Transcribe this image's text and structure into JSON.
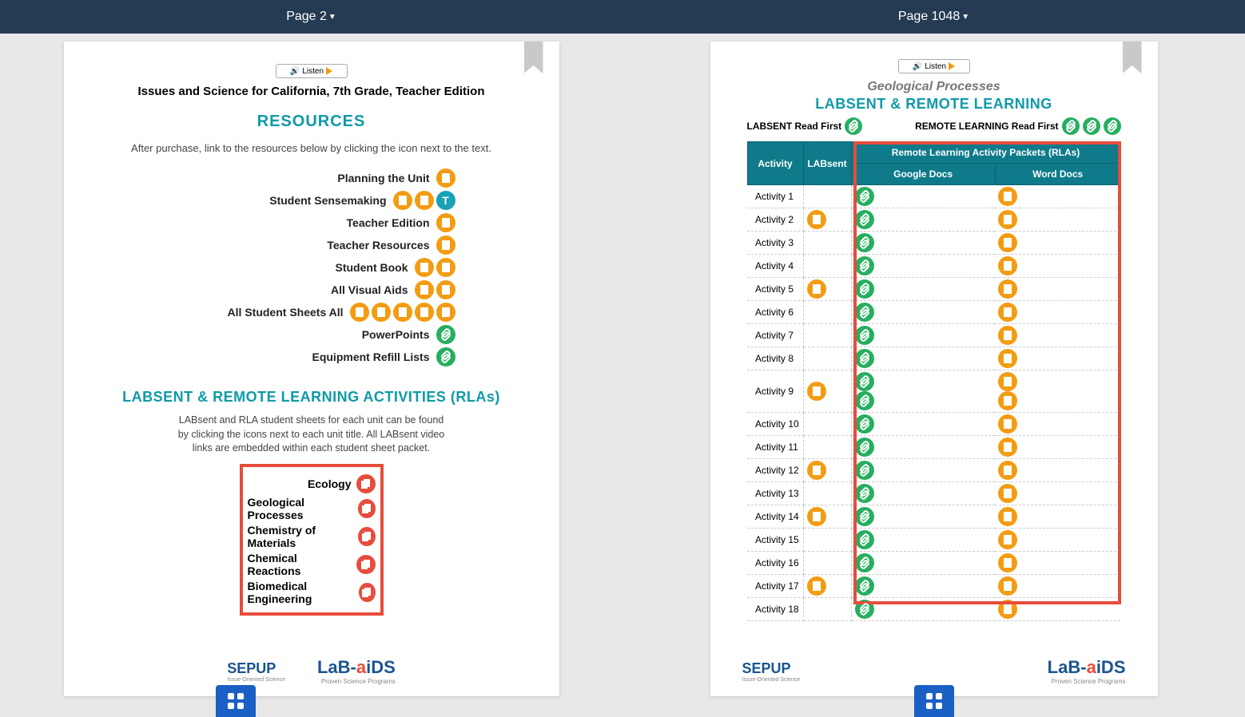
{
  "left": {
    "page_num": "Page 2",
    "listen": "Listen",
    "title": "Issues and Science for California, 7th Grade, Teacher Edition",
    "resources_h": "RESOURCES",
    "resources_sub": "After purchase, link to the resources below by clicking the icon next to the text.",
    "items": [
      {
        "label": "Planning the Unit",
        "icons": [
          "orange"
        ]
      },
      {
        "label": "Student Sensemaking",
        "icons": [
          "orange",
          "orange",
          "teal"
        ]
      },
      {
        "label": "Teacher Edition",
        "icons": [
          "orange"
        ]
      },
      {
        "label": "Teacher Resources",
        "icons": [
          "orange"
        ]
      },
      {
        "label": "Student Book",
        "icons": [
          "orange",
          "orange"
        ]
      },
      {
        "label": "All Visual Aids",
        "icons": [
          "orange",
          "orange"
        ]
      },
      {
        "label": "All Student Sheets All",
        "icons": [
          "orange",
          "orange",
          "orange",
          "orange",
          "orange"
        ]
      },
      {
        "label": "PowerPoints",
        "icons": [
          "green"
        ]
      },
      {
        "label": "Equipment Refill Lists",
        "icons": [
          "green"
        ]
      }
    ],
    "rla_h": "LABSENT & REMOTE LEARNING ACTIVITIES (RLAs)",
    "rla_sub": "LABsent and RLA student sheets for each unit can be found by clicking the icons next to each unit title. All LABsent video links are embedded within each student sheet packet.",
    "units": [
      "Ecology",
      "Geological Processes",
      "Chemistry of Materials",
      "Chemical Reactions",
      "Biomedical Engineering"
    ]
  },
  "right": {
    "page_num": "Page 1048",
    "listen": "Listen",
    "unit_title": "Geological Processes",
    "heading": "LABSENT & REMOTE LEARNING",
    "labsent_first": "LABSENT Read First",
    "remote_first": "REMOTE LEARNING Read First",
    "col_activity": "Activity",
    "col_labsent": "LABsent",
    "col_rla": "Remote Learning Activity Packets (RLAs)",
    "col_gdocs": "Google Docs",
    "col_wdocs": "Word Docs",
    "rows": [
      {
        "a": "Activity 1",
        "l": 0,
        "g": 1,
        "w": 1
      },
      {
        "a": "Activity 2",
        "l": 1,
        "g": 1,
        "w": 1
      },
      {
        "a": "Activity 3",
        "l": 0,
        "g": 1,
        "w": 1
      },
      {
        "a": "Activity 4",
        "l": 0,
        "g": 1,
        "w": 1
      },
      {
        "a": "Activity 5",
        "l": 1,
        "g": 1,
        "w": 1
      },
      {
        "a": "Activity 6",
        "l": 0,
        "g": 1,
        "w": 1
      },
      {
        "a": "Activity 7",
        "l": 0,
        "g": 1,
        "w": 1
      },
      {
        "a": "Activity 8",
        "l": 0,
        "g": 1,
        "w": 1
      },
      {
        "a": "Activity 9",
        "l": 1,
        "g": 2,
        "w": 2
      },
      {
        "a": "Activity 10",
        "l": 0,
        "g": 1,
        "w": 1
      },
      {
        "a": "Activity 11",
        "l": 0,
        "g": 1,
        "w": 1
      },
      {
        "a": "Activity 12",
        "l": 1,
        "g": 1,
        "w": 1
      },
      {
        "a": "Activity 13",
        "l": 0,
        "g": 1,
        "w": 1
      },
      {
        "a": "Activity 14",
        "l": 1,
        "g": 1,
        "w": 1
      },
      {
        "a": "Activity 15",
        "l": 0,
        "g": 1,
        "w": 1
      },
      {
        "a": "Activity 16",
        "l": 0,
        "g": 1,
        "w": 1
      },
      {
        "a": "Activity 17",
        "l": 1,
        "g": 1,
        "w": 1
      },
      {
        "a": "Activity 18",
        "l": 0,
        "g": 1,
        "w": 1
      }
    ]
  },
  "logos": {
    "sepup": "SEPUP",
    "sepup_sub": "Issue-Oriented Science",
    "labaids_pre": "LaB-",
    "labaids_post": "iDS",
    "labaids_sub": "Proven Science Programs",
    "labaids_a": "a"
  }
}
